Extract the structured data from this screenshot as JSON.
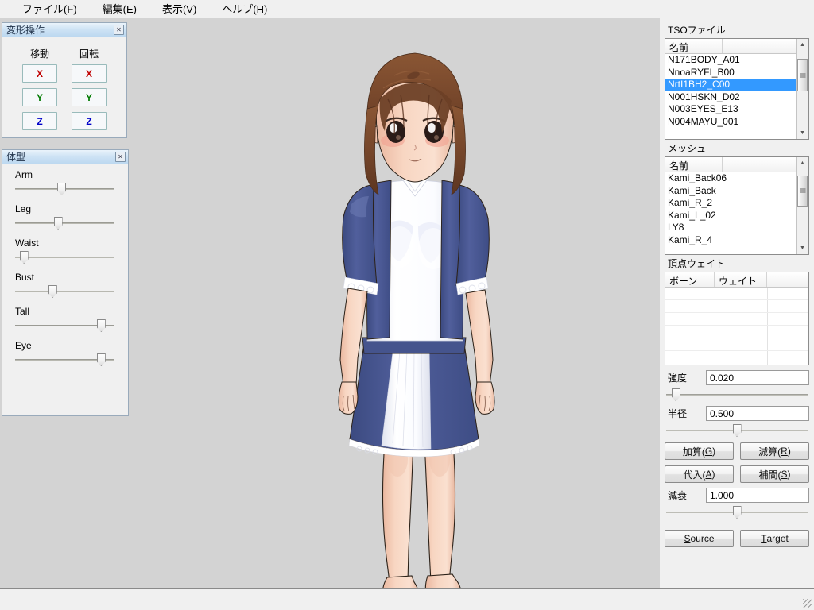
{
  "menu": {
    "items": [
      {
        "label": "ファイル(F)",
        "name": "menu-file"
      },
      {
        "label": "編集(E)",
        "name": "menu-edit"
      },
      {
        "label": "表示(V)",
        "name": "menu-view"
      },
      {
        "label": "ヘルプ(H)",
        "name": "menu-help"
      }
    ]
  },
  "transform_panel": {
    "title": "変形操作",
    "close_label": "✕",
    "columns": [
      {
        "header": "移動",
        "buttons": [
          "X",
          "Y",
          "Z"
        ]
      },
      {
        "header": "回転",
        "buttons": [
          "X",
          "Y",
          "Z"
        ]
      }
    ],
    "axis_colors": {
      "x": "#c00000",
      "y": "#007a00",
      "z": "#0000c8"
    }
  },
  "body_panel": {
    "title": "体型",
    "close_label": "✕",
    "sliders": [
      {
        "label": "Arm",
        "value": 47
      },
      {
        "label": "Leg",
        "value": 43
      },
      {
        "label": "Waist",
        "value": 5
      },
      {
        "label": "Bust",
        "value": 37
      },
      {
        "label": "Tall",
        "value": 91
      },
      {
        "label": "Eye",
        "value": 91
      }
    ]
  },
  "dock": {
    "tso": {
      "group_label": "TSOファイル",
      "columns": [
        "名前",
        ""
      ],
      "rows": [
        {
          "name": "N171BODY_A01",
          "selected": false
        },
        {
          "name": "NnoaRYFI_B00",
          "selected": false
        },
        {
          "name": "NrtI1BH2_C00",
          "selected": true
        },
        {
          "name": "N001HSKN_D02",
          "selected": false
        },
        {
          "name": "N003EYES_E13",
          "selected": false
        },
        {
          "name": "N004MAYU_001",
          "selected": false
        }
      ],
      "scroll_percent": 18
    },
    "mesh": {
      "group_label": "メッシュ",
      "columns": [
        "名前",
        ""
      ],
      "rows": [
        {
          "name": "Kami_Back06",
          "selected": false
        },
        {
          "name": "Kami_Back",
          "selected": false
        },
        {
          "name": "Kami_R_2",
          "selected": false
        },
        {
          "name": "Kami_L_02",
          "selected": false
        },
        {
          "name": "LY8",
          "selected": false
        },
        {
          "name": "Kami_R_4",
          "selected": false
        }
      ],
      "scroll_percent": 14
    },
    "weights": {
      "group_label": "頂点ウェイト",
      "columns": [
        "ボーン",
        "ウェイト",
        ""
      ],
      "rows": []
    },
    "strength": {
      "label": "強度",
      "value": "0.020",
      "slider_percent": 4
    },
    "radius": {
      "label": "半径",
      "value": "0.500",
      "slider_percent": 50
    },
    "ops": [
      {
        "label": "加算(G)",
        "text": "加算(",
        "accel": "G",
        "tail": ")",
        "name": "add-button"
      },
      {
        "label": "減算(R)",
        "text": "減算(",
        "accel": "R",
        "tail": ")",
        "name": "subtract-button"
      },
      {
        "label": "代入(A)",
        "text": "代入(",
        "accel": "A",
        "tail": ")",
        "name": "assign-button"
      },
      {
        "label": "補間(S)",
        "text": "補間(",
        "accel": "S",
        "tail": ")",
        "name": "interpolate-button"
      }
    ],
    "decay": {
      "label": "減衰",
      "value": "1.000",
      "slider_percent": 50
    },
    "source_button": {
      "text": "",
      "accel": "S",
      "tail": "ource"
    },
    "target_button": {
      "text": "",
      "accel": "T",
      "tail": "arget"
    }
  },
  "viewport": {
    "background": "#d3d3d3",
    "character": {
      "skin": "#f6d2be",
      "skin_shadow": "#e8b9a2",
      "hair": "#7d4a2e",
      "hair_dark": "#5d3420",
      "hair_light": "#9a6240",
      "dress_navy": "#4c5c97",
      "dress_navy_dark": "#3d4c82",
      "cloth_white": "#ffffff",
      "cloth_shade": "#e4e6ef",
      "outline": "#2b2118"
    }
  },
  "statusbar": {
    "text": ""
  }
}
